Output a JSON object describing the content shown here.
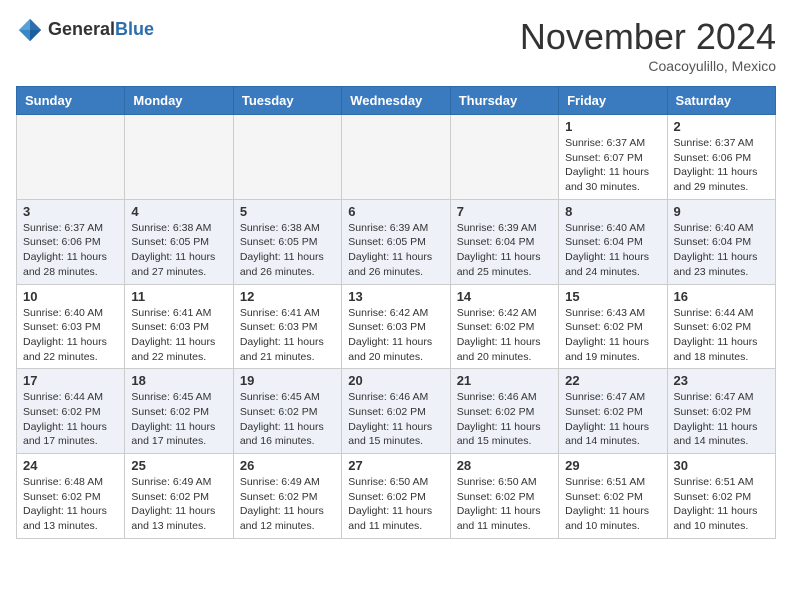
{
  "header": {
    "logo_general": "General",
    "logo_blue": "Blue",
    "month_title": "November 2024",
    "location": "Coacoyulillo, Mexico"
  },
  "days_of_week": [
    "Sunday",
    "Monday",
    "Tuesday",
    "Wednesday",
    "Thursday",
    "Friday",
    "Saturday"
  ],
  "weeks": [
    [
      {
        "day": "",
        "info": ""
      },
      {
        "day": "",
        "info": ""
      },
      {
        "day": "",
        "info": ""
      },
      {
        "day": "",
        "info": ""
      },
      {
        "day": "",
        "info": ""
      },
      {
        "day": "1",
        "info": "Sunrise: 6:37 AM\nSunset: 6:07 PM\nDaylight: 11 hours and 30 minutes."
      },
      {
        "day": "2",
        "info": "Sunrise: 6:37 AM\nSunset: 6:06 PM\nDaylight: 11 hours and 29 minutes."
      }
    ],
    [
      {
        "day": "3",
        "info": "Sunrise: 6:37 AM\nSunset: 6:06 PM\nDaylight: 11 hours and 28 minutes."
      },
      {
        "day": "4",
        "info": "Sunrise: 6:38 AM\nSunset: 6:05 PM\nDaylight: 11 hours and 27 minutes."
      },
      {
        "day": "5",
        "info": "Sunrise: 6:38 AM\nSunset: 6:05 PM\nDaylight: 11 hours and 26 minutes."
      },
      {
        "day": "6",
        "info": "Sunrise: 6:39 AM\nSunset: 6:05 PM\nDaylight: 11 hours and 26 minutes."
      },
      {
        "day": "7",
        "info": "Sunrise: 6:39 AM\nSunset: 6:04 PM\nDaylight: 11 hours and 25 minutes."
      },
      {
        "day": "8",
        "info": "Sunrise: 6:40 AM\nSunset: 6:04 PM\nDaylight: 11 hours and 24 minutes."
      },
      {
        "day": "9",
        "info": "Sunrise: 6:40 AM\nSunset: 6:04 PM\nDaylight: 11 hours and 23 minutes."
      }
    ],
    [
      {
        "day": "10",
        "info": "Sunrise: 6:40 AM\nSunset: 6:03 PM\nDaylight: 11 hours and 22 minutes."
      },
      {
        "day": "11",
        "info": "Sunrise: 6:41 AM\nSunset: 6:03 PM\nDaylight: 11 hours and 22 minutes."
      },
      {
        "day": "12",
        "info": "Sunrise: 6:41 AM\nSunset: 6:03 PM\nDaylight: 11 hours and 21 minutes."
      },
      {
        "day": "13",
        "info": "Sunrise: 6:42 AM\nSunset: 6:03 PM\nDaylight: 11 hours and 20 minutes."
      },
      {
        "day": "14",
        "info": "Sunrise: 6:42 AM\nSunset: 6:02 PM\nDaylight: 11 hours and 20 minutes."
      },
      {
        "day": "15",
        "info": "Sunrise: 6:43 AM\nSunset: 6:02 PM\nDaylight: 11 hours and 19 minutes."
      },
      {
        "day": "16",
        "info": "Sunrise: 6:44 AM\nSunset: 6:02 PM\nDaylight: 11 hours and 18 minutes."
      }
    ],
    [
      {
        "day": "17",
        "info": "Sunrise: 6:44 AM\nSunset: 6:02 PM\nDaylight: 11 hours and 17 minutes."
      },
      {
        "day": "18",
        "info": "Sunrise: 6:45 AM\nSunset: 6:02 PM\nDaylight: 11 hours and 17 minutes."
      },
      {
        "day": "19",
        "info": "Sunrise: 6:45 AM\nSunset: 6:02 PM\nDaylight: 11 hours and 16 minutes."
      },
      {
        "day": "20",
        "info": "Sunrise: 6:46 AM\nSunset: 6:02 PM\nDaylight: 11 hours and 15 minutes."
      },
      {
        "day": "21",
        "info": "Sunrise: 6:46 AM\nSunset: 6:02 PM\nDaylight: 11 hours and 15 minutes."
      },
      {
        "day": "22",
        "info": "Sunrise: 6:47 AM\nSunset: 6:02 PM\nDaylight: 11 hours and 14 minutes."
      },
      {
        "day": "23",
        "info": "Sunrise: 6:47 AM\nSunset: 6:02 PM\nDaylight: 11 hours and 14 minutes."
      }
    ],
    [
      {
        "day": "24",
        "info": "Sunrise: 6:48 AM\nSunset: 6:02 PM\nDaylight: 11 hours and 13 minutes."
      },
      {
        "day": "25",
        "info": "Sunrise: 6:49 AM\nSunset: 6:02 PM\nDaylight: 11 hours and 13 minutes."
      },
      {
        "day": "26",
        "info": "Sunrise: 6:49 AM\nSunset: 6:02 PM\nDaylight: 11 hours and 12 minutes."
      },
      {
        "day": "27",
        "info": "Sunrise: 6:50 AM\nSunset: 6:02 PM\nDaylight: 11 hours and 11 minutes."
      },
      {
        "day": "28",
        "info": "Sunrise: 6:50 AM\nSunset: 6:02 PM\nDaylight: 11 hours and 11 minutes."
      },
      {
        "day": "29",
        "info": "Sunrise: 6:51 AM\nSunset: 6:02 PM\nDaylight: 11 hours and 10 minutes."
      },
      {
        "day": "30",
        "info": "Sunrise: 6:51 AM\nSunset: 6:02 PM\nDaylight: 11 hours and 10 minutes."
      }
    ]
  ]
}
